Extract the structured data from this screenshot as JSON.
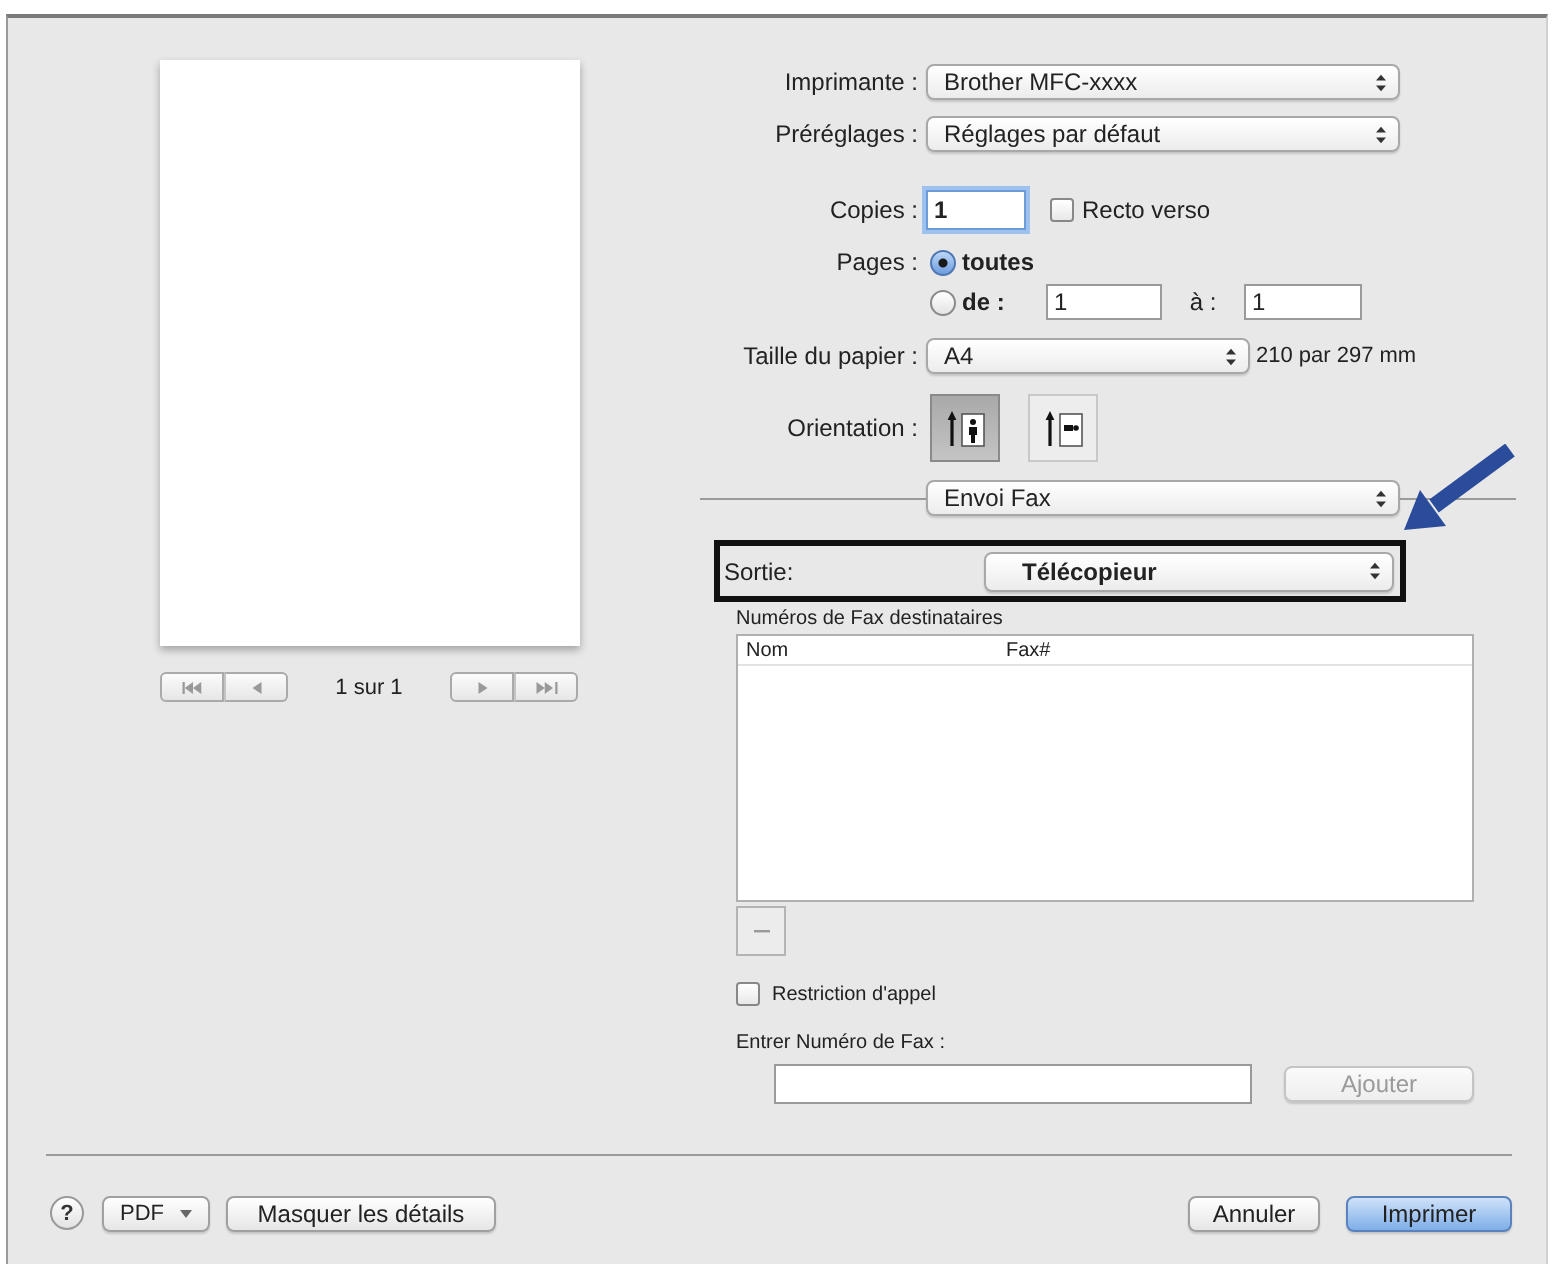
{
  "preview": {
    "page_counter": "1 sur 1"
  },
  "printer": {
    "label": "Imprimante :",
    "value": "Brother MFC-xxxx"
  },
  "presets": {
    "label": "Préréglages :",
    "value": "Réglages par défaut"
  },
  "copies": {
    "label": "Copies :",
    "value": "1",
    "focused": true
  },
  "duplex": {
    "label": "Recto verso",
    "checked": false
  },
  "pages": {
    "label": "Pages :",
    "options": [
      {
        "label": "toutes",
        "selected": true
      },
      {
        "label": "de :",
        "selected": false
      }
    ],
    "from": "1",
    "to_label": "à :",
    "to": "1"
  },
  "paper_size": {
    "label": "Taille du papier :",
    "value": "A4",
    "dimensions": "210 par 297 mm"
  },
  "orientation": {
    "label": "Orientation :",
    "options": [
      {
        "kind": "portrait",
        "selected": true
      },
      {
        "kind": "landscape",
        "selected": false
      }
    ]
  },
  "panel_menu": {
    "value": "Envoi Fax",
    "pointed_out": true
  },
  "output": {
    "label": "Sortie:",
    "value": "Télécopieur",
    "outlined": true
  },
  "recipients": {
    "label": "Numéros de Fax destinataires",
    "columns": [
      "Nom",
      "Fax#"
    ],
    "remove_disabled": true
  },
  "call_restriction": {
    "label": "Restriction d'appel",
    "checked": false
  },
  "fax_entry": {
    "label": "Entrer Numéro de Fax :",
    "add_button": {
      "label": "Ajouter",
      "disabled": true
    }
  },
  "footer": {
    "help": "?",
    "pdf": "PDF",
    "details": "Masquer les détails",
    "buttons": [
      {
        "label": "Annuler",
        "default": false
      },
      {
        "label": "Imprimer",
        "default": true
      }
    ]
  }
}
